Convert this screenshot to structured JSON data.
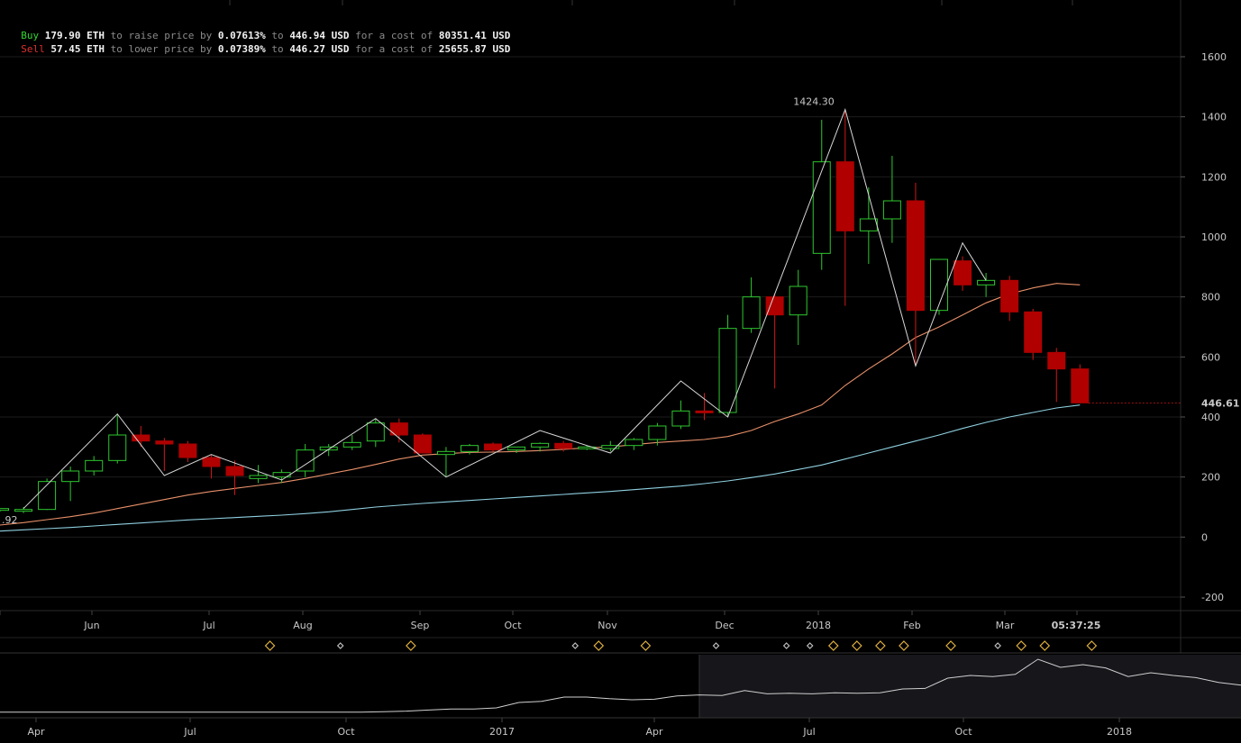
{
  "order_info": {
    "buy": {
      "label": "Buy",
      "amount": "179.90 ETH",
      "t1": " to raise price by ",
      "pct": "0.07613%",
      "t2": " to ",
      "price": "446.94 USD",
      "t3": " for a cost of ",
      "cost": "80351.41 USD"
    },
    "sell": {
      "label": "Sell",
      "amount": "57.45 ETH",
      "t1": " to lower price by ",
      "pct": "0.07389%",
      "t2": " to ",
      "price": "446.27 USD",
      "t3": " for a cost of ",
      "cost": "25655.87 USD"
    }
  },
  "colors": {
    "up": "#2ec72e",
    "down": "#b00000",
    "down_wick": "#d01818",
    "ma_short": "#e8906a",
    "ma_long": "#8fd0e0",
    "zigzag": "#d8d8d8",
    "background": "#000000",
    "grid": "#1c1c1c"
  },
  "chart_data": {
    "type": "candlestick",
    "x_axis": {
      "labels": [
        "y",
        "Jun",
        "Jul",
        "Aug",
        "Sep",
        "Oct",
        "Nov",
        "Dec",
        "2018",
        "Feb",
        "Mar"
      ],
      "countdown": "05:37:25"
    },
    "y_axis": {
      "ticks": [
        1600,
        1400,
        1200,
        1000,
        800,
        600,
        400,
        200,
        0,
        -200
      ],
      "range": [
        -245,
        1765
      ]
    },
    "current_price": 446.61,
    "current_price_label": "446.61",
    "peak_label": "1424.30",
    "left_edge_label": ".92",
    "candles": [
      {
        "o": 90,
        "h": 95,
        "l": 85,
        "c": 95
      },
      {
        "o": 90,
        "h": 100,
        "l": 80,
        "c": 92
      },
      {
        "o": 92,
        "h": 195,
        "l": 90,
        "c": 185
      },
      {
        "o": 185,
        "h": 235,
        "l": 120,
        "c": 220
      },
      {
        "o": 220,
        "h": 270,
        "l": 205,
        "c": 255
      },
      {
        "o": 255,
        "h": 410,
        "l": 245,
        "c": 340
      },
      {
        "o": 340,
        "h": 370,
        "l": 300,
        "c": 320
      },
      {
        "o": 320,
        "h": 330,
        "l": 220,
        "c": 310
      },
      {
        "o": 310,
        "h": 320,
        "l": 250,
        "c": 265
      },
      {
        "o": 265,
        "h": 275,
        "l": 195,
        "c": 235
      },
      {
        "o": 235,
        "h": 255,
        "l": 140,
        "c": 205
      },
      {
        "o": 195,
        "h": 240,
        "l": 180,
        "c": 205
      },
      {
        "o": 200,
        "h": 225,
        "l": 180,
        "c": 215
      },
      {
        "o": 220,
        "h": 310,
        "l": 200,
        "c": 290
      },
      {
        "o": 290,
        "h": 310,
        "l": 270,
        "c": 300
      },
      {
        "o": 300,
        "h": 340,
        "l": 290,
        "c": 315
      },
      {
        "o": 320,
        "h": 395,
        "l": 300,
        "c": 380
      },
      {
        "o": 380,
        "h": 395,
        "l": 315,
        "c": 340
      },
      {
        "o": 340,
        "h": 345,
        "l": 280,
        "c": 280
      },
      {
        "o": 275,
        "h": 300,
        "l": 200,
        "c": 285
      },
      {
        "o": 285,
        "h": 310,
        "l": 275,
        "c": 305
      },
      {
        "o": 310,
        "h": 315,
        "l": 285,
        "c": 290
      },
      {
        "o": 290,
        "h": 300,
        "l": 280,
        "c": 300
      },
      {
        "o": 300,
        "h": 315,
        "l": 285,
        "c": 312
      },
      {
        "o": 312,
        "h": 320,
        "l": 285,
        "c": 295
      },
      {
        "o": 295,
        "h": 305,
        "l": 290,
        "c": 300
      },
      {
        "o": 295,
        "h": 320,
        "l": 285,
        "c": 305
      },
      {
        "o": 305,
        "h": 330,
        "l": 290,
        "c": 325
      },
      {
        "o": 325,
        "h": 380,
        "l": 305,
        "c": 370
      },
      {
        "o": 370,
        "h": 455,
        "l": 360,
        "c": 420
      },
      {
        "o": 420,
        "h": 480,
        "l": 390,
        "c": 415
      },
      {
        "o": 415,
        "h": 740,
        "l": 400,
        "c": 695
      },
      {
        "o": 695,
        "h": 865,
        "l": 680,
        "c": 800
      },
      {
        "o": 800,
        "h": 810,
        "l": 495,
        "c": 740
      },
      {
        "o": 740,
        "h": 890,
        "l": 640,
        "c": 835
      },
      {
        "o": 945,
        "h": 1390,
        "l": 890,
        "c": 1250
      },
      {
        "o": 1250,
        "h": 1420,
        "l": 770,
        "c": 1020
      },
      {
        "o": 1020,
        "h": 1165,
        "l": 910,
        "c": 1060
      },
      {
        "o": 1060,
        "h": 1270,
        "l": 980,
        "c": 1120
      },
      {
        "o": 1120,
        "h": 1180,
        "l": 570,
        "c": 755
      },
      {
        "o": 755,
        "h": 925,
        "l": 740,
        "c": 925
      },
      {
        "o": 920,
        "h": 935,
        "l": 820,
        "c": 840
      },
      {
        "o": 840,
        "h": 880,
        "l": 800,
        "c": 855
      },
      {
        "o": 855,
        "h": 870,
        "l": 720,
        "c": 750
      },
      {
        "o": 750,
        "h": 760,
        "l": 590,
        "c": 615
      },
      {
        "o": 615,
        "h": 630,
        "l": 450,
        "c": 560
      },
      {
        "o": 560,
        "h": 575,
        "l": 445,
        "c": 447
      }
    ],
    "ma_short": [
      40,
      48,
      58,
      68,
      80,
      95,
      110,
      125,
      140,
      152,
      162,
      172,
      182,
      195,
      210,
      225,
      242,
      260,
      273,
      278,
      282,
      283,
      285,
      288,
      292,
      297,
      300,
      308,
      315,
      320,
      325,
      335,
      355,
      385,
      410,
      440,
      505,
      560,
      610,
      665,
      700,
      740,
      780,
      810,
      830,
      845,
      840
    ],
    "ma_long": [
      20,
      24,
      28,
      32,
      37,
      42,
      47,
      52,
      57,
      61,
      65,
      69,
      73,
      78,
      84,
      92,
      100,
      106,
      112,
      117,
      122,
      127,
      132,
      137,
      142,
      147,
      152,
      158,
      164,
      170,
      178,
      187,
      198,
      210,
      225,
      240,
      260,
      280,
      300,
      320,
      340,
      362,
      382,
      400,
      415,
      430,
      440
    ],
    "zigzag": [
      [
        1,
        95
      ],
      [
        5,
        410
      ],
      [
        7,
        205
      ],
      [
        9,
        275
      ],
      [
        12,
        190
      ],
      [
        16,
        395
      ],
      [
        19,
        200
      ],
      [
        23,
        355
      ],
      [
        26,
        280
      ],
      [
        29,
        520
      ],
      [
        31,
        400
      ],
      [
        36,
        1424.3
      ],
      [
        39,
        570
      ],
      [
        41,
        980
      ],
      [
        42,
        855
      ]
    ],
    "markers": [
      {
        "i": 11.5,
        "size": "large"
      },
      {
        "i": 14.5,
        "size": "small"
      },
      {
        "i": 17.5,
        "size": "large"
      },
      {
        "i": 24.5,
        "size": "small"
      },
      {
        "i": 25.5,
        "size": "large"
      },
      {
        "i": 27.5,
        "size": "large"
      },
      {
        "i": 30.5,
        "size": "small"
      },
      {
        "i": 33.5,
        "size": "small"
      },
      {
        "i": 34.5,
        "size": "small"
      },
      {
        "i": 35.5,
        "size": "large"
      },
      {
        "i": 36.5,
        "size": "large"
      },
      {
        "i": 37.5,
        "size": "large"
      },
      {
        "i": 38.5,
        "size": "large"
      },
      {
        "i": 40.5,
        "size": "large"
      },
      {
        "i": 42.5,
        "size": "small"
      },
      {
        "i": 43.5,
        "size": "large"
      },
      {
        "i": 44.5,
        "size": "large"
      },
      {
        "i": 46.5,
        "size": "large"
      }
    ],
    "navigator": {
      "labels": [
        "Apr",
        "Jul",
        "Oct",
        "2017",
        "Apr",
        "Jul",
        "Oct",
        "2018"
      ],
      "values": [
        0.02,
        0.02,
        0.02,
        0.02,
        0.02,
        0.02,
        0.02,
        0.02,
        0.02,
        0.02,
        0.02,
        0.02,
        0.02,
        0.02,
        0.02,
        0.02,
        0.02,
        0.03,
        0.04,
        0.06,
        0.08,
        0.08,
        0.1,
        0.2,
        0.22,
        0.3,
        0.3,
        0.27,
        0.25,
        0.26,
        0.32,
        0.34,
        0.33,
        0.42,
        0.36,
        0.37,
        0.36,
        0.38,
        0.37,
        0.38,
        0.45,
        0.46,
        0.65,
        0.7,
        0.68,
        0.72,
        1.0,
        0.85,
        0.9,
        0.84,
        0.68,
        0.75,
        0.7,
        0.66,
        0.57,
        0.52
      ]
    }
  }
}
